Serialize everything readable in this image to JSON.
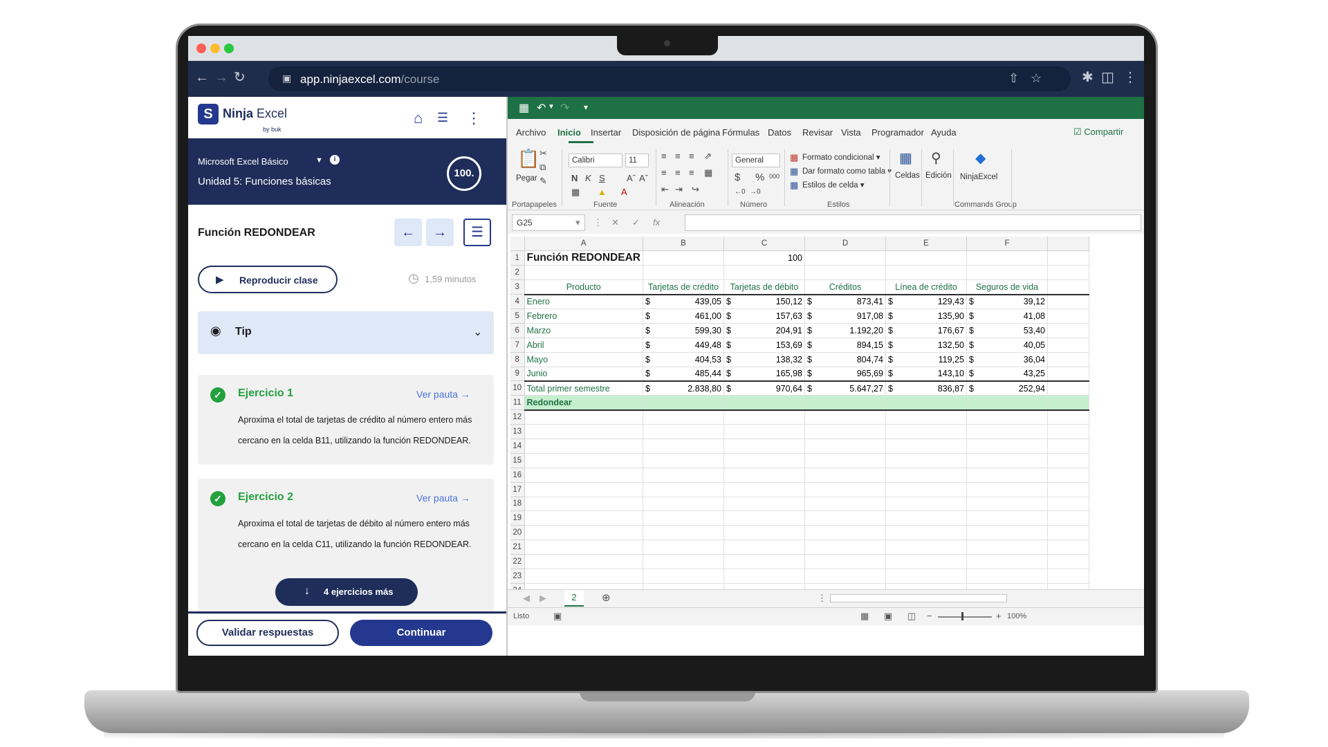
{
  "browser": {
    "url_host": "app.ninjaexcel.com",
    "url_path": "/course",
    "traffic_lights": [
      "#ff5f57",
      "#febc2e",
      "#28c840"
    ]
  },
  "app": {
    "logo_text_bold": "Ninja",
    "logo_text": "Excel",
    "logo_sub": "by buk",
    "course_name": "Microsoft Excel Básico",
    "unit_name": "Unidad 5: Funciones básicas",
    "score": "100.",
    "lesson_title": "Función REDONDEAR",
    "play_label": "Reproducir clase",
    "duration": "1,59 minutos",
    "tip_label": "Tip",
    "exercises": [
      {
        "title": "Ejercicio 1",
        "link": "Ver pauta",
        "text": "Aproxima el total de tarjetas de crédito al número entero más cercano en la celda B11, utilizando la función REDONDEAR."
      },
      {
        "title": "Ejercicio 2",
        "link": "Ver pauta",
        "text": "Aproxima el total de tarjetas de débito al número entero más cercano en la celda C11, utilizando la función REDONDEAR."
      }
    ],
    "more_label": "4 ejercicios más",
    "validate_label": "Validar respuestas",
    "continue_label": "Continuar"
  },
  "excel": {
    "tabs": [
      "Archivo",
      "Inicio",
      "Insertar",
      "Disposición de página",
      "Fórmulas",
      "Datos",
      "Revisar",
      "Vista",
      "Programador",
      "Ayuda"
    ],
    "share_label": "Compartir",
    "paste_label": "Pegar",
    "font_name": "Calibri",
    "font_size": "11",
    "number_format": "General",
    "styles": [
      "Formato condicional",
      "Dar formato como tabla",
      "Estilos de celda"
    ],
    "cells_label": "Celdas",
    "edit_label": "Edición",
    "ninja_label": "NinjaExcel",
    "groups": [
      "Portapapeles",
      "Fuente",
      "Alineación",
      "Número",
      "Estilos",
      "Commands Group"
    ],
    "name_box": "G25",
    "columns": [
      "A",
      "B",
      "C",
      "D",
      "E",
      "F"
    ],
    "title": "Función REDONDEAR",
    "title_value": "100",
    "headers": [
      "Producto",
      "Tarjetas de crédito",
      "Tarjetas de débito",
      "Créditos",
      "Línea de crédito",
      "Seguros de vida"
    ],
    "rows": [
      {
        "label": "Enero",
        "values": [
          "439,05",
          "150,12",
          "873,41",
          "129,43",
          "39,12"
        ]
      },
      {
        "label": "Febrero",
        "values": [
          "461,00",
          "157,63",
          "917,08",
          "135,90",
          "41,08"
        ]
      },
      {
        "label": "Marzo",
        "values": [
          "599,30",
          "204,91",
          "1.192,20",
          "176,67",
          "53,40"
        ]
      },
      {
        "label": "Abril",
        "values": [
          "449,48",
          "153,69",
          "894,15",
          "132,50",
          "40,05"
        ]
      },
      {
        "label": "Mayo",
        "values": [
          "404,53",
          "138,32",
          "804,74",
          "119,25",
          "36,04"
        ]
      },
      {
        "label": "Junio",
        "values": [
          "485,44",
          "165,98",
          "965,69",
          "143,10",
          "43,25"
        ]
      }
    ],
    "total": {
      "label": "Total primer semestre",
      "values": [
        "2.838,80",
        "970,64",
        "5.647,27",
        "836,87",
        "252,94"
      ]
    },
    "round_label": "Redondear",
    "currency": "$",
    "sheet_tab": "2",
    "status": "Listo",
    "zoom": "100%",
    "accent": "#1e7145"
  }
}
